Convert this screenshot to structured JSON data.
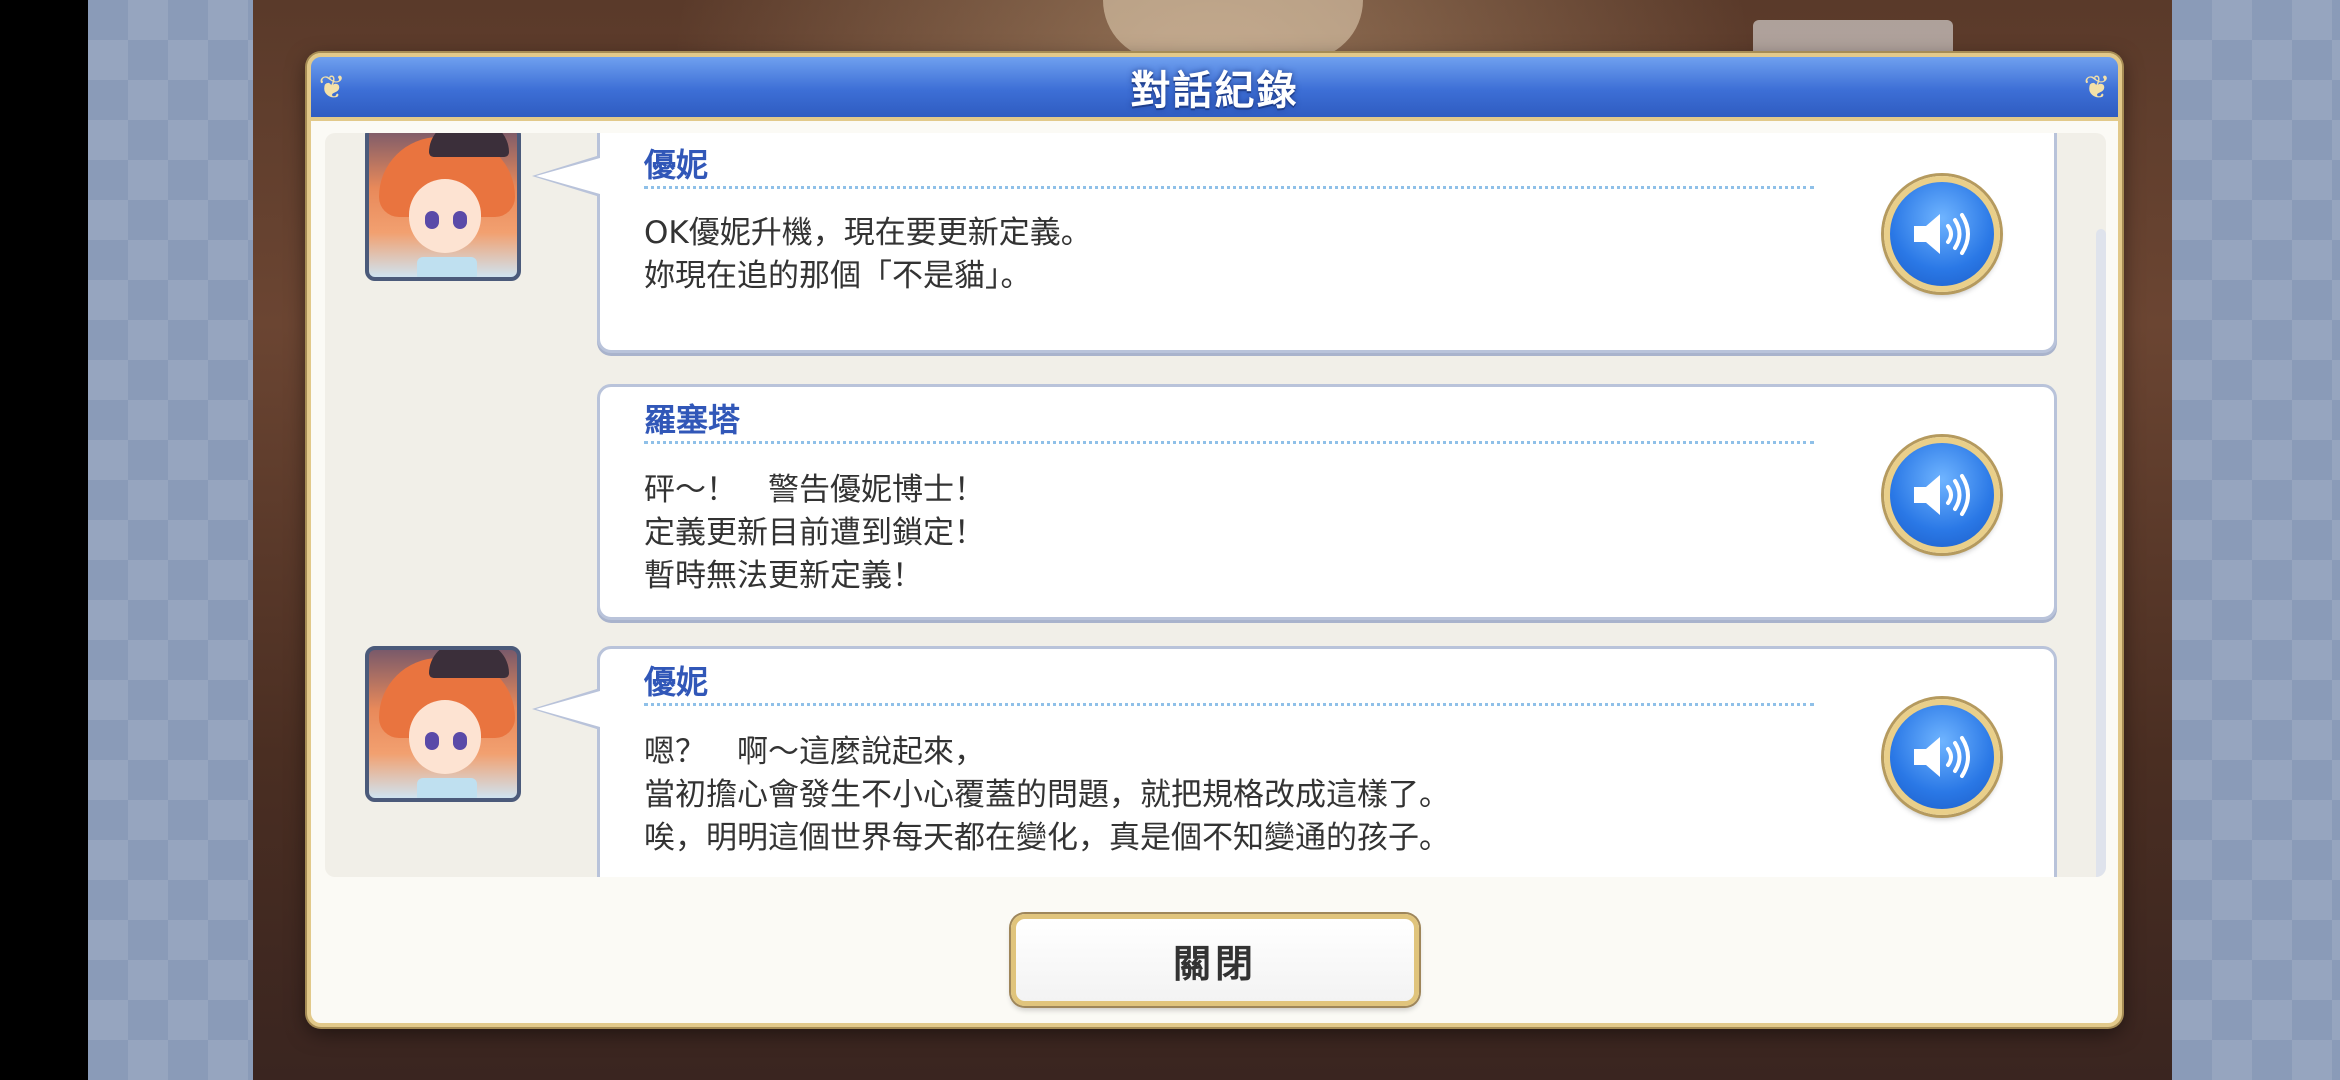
{
  "dialog": {
    "title": "對話紀錄",
    "close_label": "關閉"
  },
  "entries": [
    {
      "speaker": "優妮",
      "has_portrait": true,
      "lines": [
        "OK優妮升機，現在要更新定義。",
        "妳現在追的那個「不是貓」。"
      ]
    },
    {
      "speaker": "羅塞塔",
      "has_portrait": false,
      "lines": [
        "砰～！　警告優妮博士！",
        "定義更新目前遭到鎖定！",
        "暫時無法更新定義！"
      ]
    },
    {
      "speaker": "優妮",
      "has_portrait": true,
      "lines": [
        "嗯？　啊～這麼說起來，",
        "當初擔心會發生不小心覆蓋的問題，就把規格改成這樣了。",
        "唉，明明這個世界每天都在變化，真是個不知變通的孩子。"
      ]
    }
  ],
  "icons": {
    "voice": "speaker-icon",
    "corner": "ornament-icon"
  },
  "colors": {
    "title_bar": "#3d6fd6",
    "frame_gold": "#e2c98a",
    "speaker_name": "#3157b8",
    "voice_button": "#2a78e6"
  }
}
